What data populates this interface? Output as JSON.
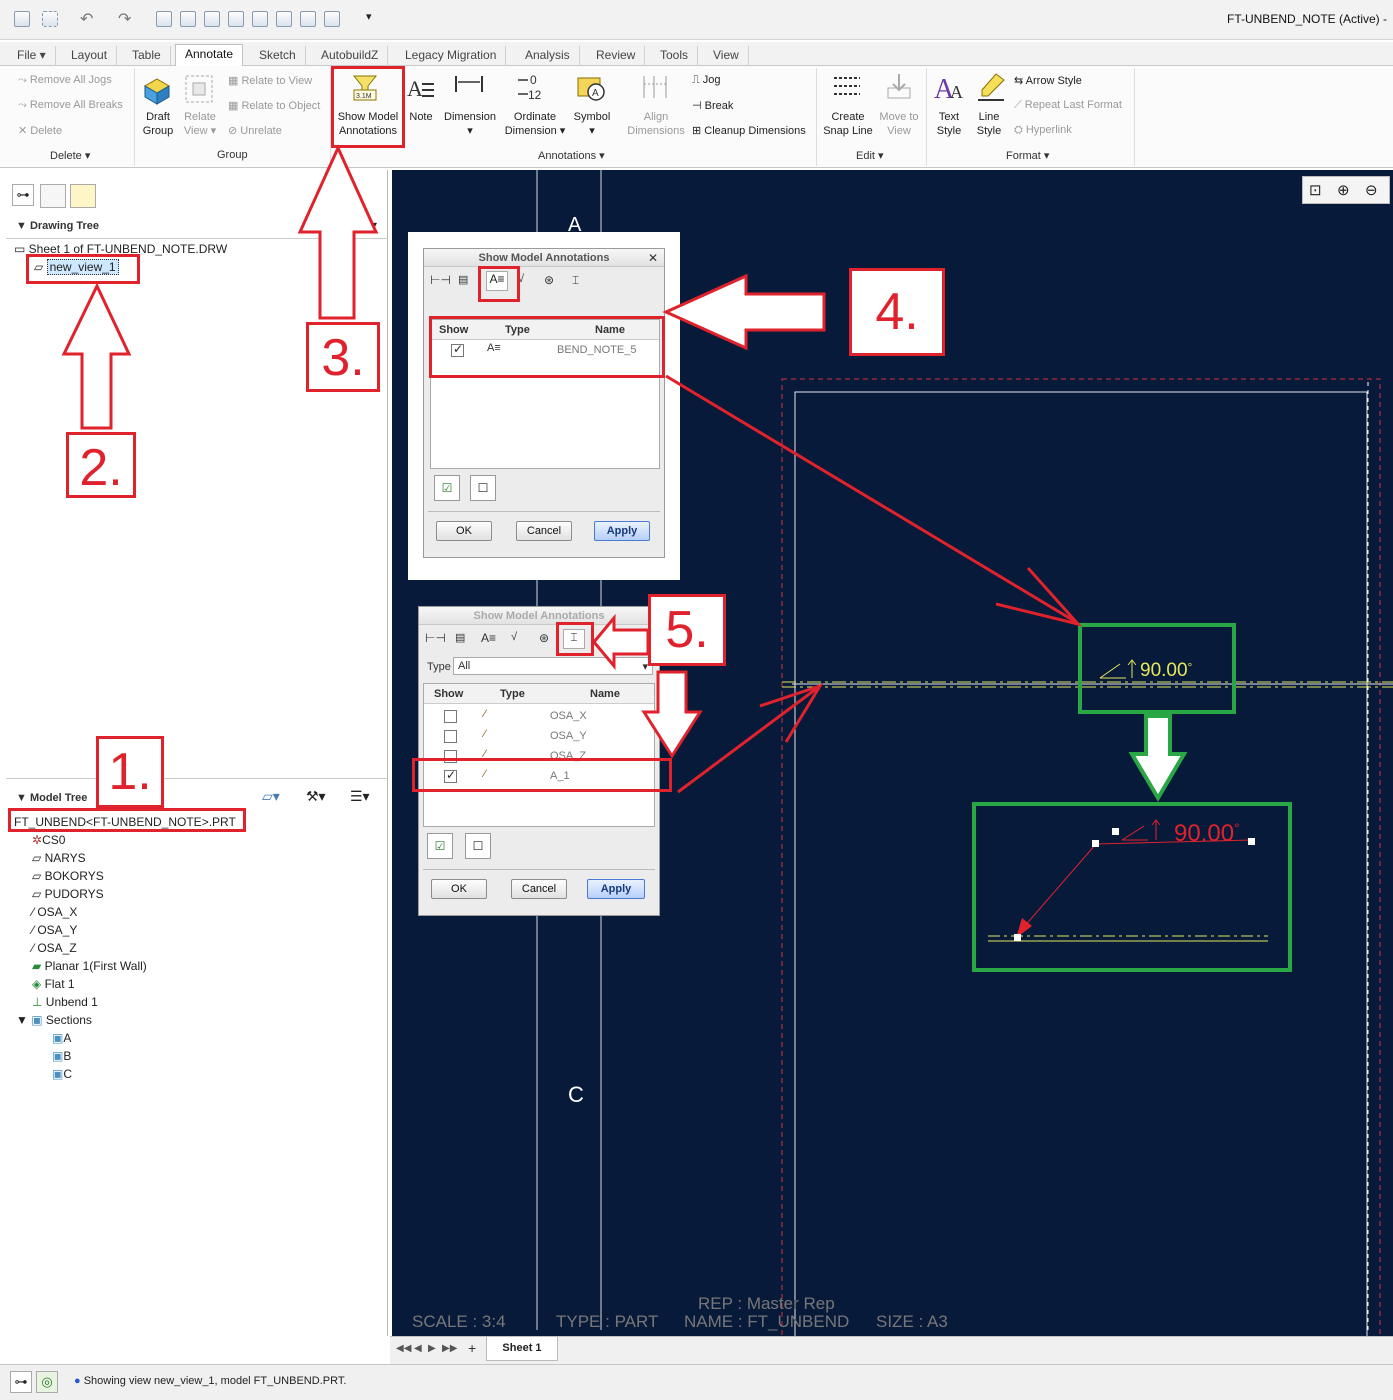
{
  "window": {
    "title": "FT-UNBEND_NOTE (Active) -"
  },
  "tabs": [
    "File ▾",
    "Layout",
    "Table",
    "Annotate",
    "Sketch",
    "AutobuildZ",
    "Legacy Migration",
    "Analysis",
    "Review",
    "Tools",
    "View"
  ],
  "ribbon": {
    "delete_group": {
      "items": [
        "Remove All Jogs",
        "Remove All Breaks",
        "Delete"
      ],
      "label": "Delete ▾"
    },
    "group_group": {
      "draft_group": "Draft\nGroup",
      "relate_view": "Relate\nView ▾",
      "items": [
        "Relate to View",
        "Relate to Object",
        "Unrelate"
      ],
      "label": "Group"
    },
    "annotations_group": {
      "show_model": "Show Model\nAnnotations",
      "note": "Note",
      "dimension": "Dimension\n▾",
      "ordinate": "Ordinate\nDimension ▾",
      "symbol": "Symbol\n▾",
      "align": "Align\nDimensions",
      "items": [
        "Jog",
        "Break",
        "Cleanup Dimensions"
      ],
      "label": "Annotations ▾"
    },
    "edit_group": {
      "snap": "Create\nSnap Line",
      "move": "Move to\nView",
      "label": "Edit ▾"
    },
    "format_group": {
      "text_style": "Text\nStyle",
      "line_style": "Line\nStyle",
      "items": [
        "Arrow Style",
        "Repeat Last Format",
        "Hyperlink"
      ],
      "label": "Format ▾"
    }
  },
  "drawing_tree": {
    "header": "Drawing Tree",
    "sheet": "Sheet 1 of FT-UNBEND_NOTE.DRW",
    "view": "new_view_1"
  },
  "model_tree": {
    "header": "Model Tree",
    "root": "FT_UNBEND<FT-UNBEND_NOTE>.PRT",
    "items": [
      "CS0",
      "NARYS",
      "BOKORYS",
      "PUDORYS",
      "OSA_X",
      "OSA_Y",
      "OSA_Z",
      "Planar 1(First Wall)",
      "Flat 1",
      "Unbend 1",
      "Sections"
    ],
    "sections": [
      "A",
      "B",
      "C"
    ]
  },
  "dialog1": {
    "title": "Show Model Annotations",
    "cols": [
      "Show",
      "Type",
      "Name"
    ],
    "row_name": "BEND_NOTE_5",
    "ok": "OK",
    "cancel": "Cancel",
    "apply": "Apply"
  },
  "dialog2": {
    "title": "Show Model Annotations",
    "type_label": "Type",
    "type_value": "All",
    "cols": [
      "Show",
      "Type",
      "Name"
    ],
    "rows": [
      "OSA_X",
      "OSA_Y",
      "OSA_Z",
      "A_1"
    ],
    "ok": "OK",
    "cancel": "Cancel",
    "apply": "Apply"
  },
  "annotations": {
    "n1": "1.",
    "n2": "2.",
    "n3": "3.",
    "n4": "4.",
    "n5": "5."
  },
  "canvas": {
    "section_a": "A",
    "section_c": "C",
    "dim_top": "90.00",
    "dim_bottom": "90.00",
    "degree": "°",
    "footer": {
      "rep": "REP : Master Rep",
      "scale": "SCALE : 3:4",
      "type": "TYPE : PART",
      "name": "NAME : FT_UNBEND",
      "size": "SIZE : A3"
    }
  },
  "sheet_tab": "Sheet 1",
  "status": "Showing view new_view_1, model FT_UNBEND.PRT.",
  "colors": {
    "canvas": "#071a3a",
    "red": "#e0222c",
    "green": "#29a744",
    "yellow": "#e6e65a"
  }
}
